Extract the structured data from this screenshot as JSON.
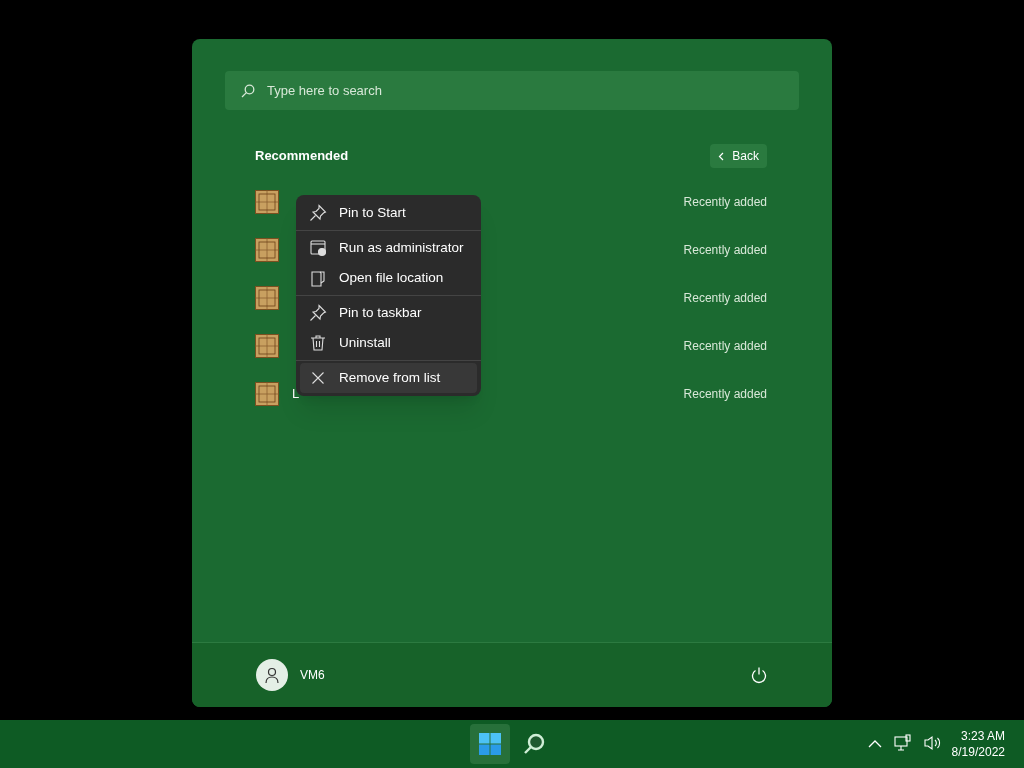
{
  "search": {
    "placeholder": "Type here to search"
  },
  "recommended": {
    "title": "Recommended",
    "back_button": "Back",
    "items": [
      {
        "detail": "Recently added"
      },
      {
        "detail": "Recently added"
      },
      {
        "detail": "Recently added"
      },
      {
        "detail": "Recently added"
      },
      {
        "name": "L",
        "detail": "Recently added"
      }
    ]
  },
  "context_menu": {
    "groups": [
      [
        {
          "kind": "pin",
          "label": "Pin to Start",
          "selected": false
        }
      ],
      [
        {
          "kind": "admin",
          "label": "Run as administrator",
          "selected": false
        },
        {
          "kind": "folder",
          "label": "Open file location",
          "selected": false
        }
      ],
      [
        {
          "kind": "pin",
          "label": "Pin to taskbar",
          "selected": false
        },
        {
          "kind": "trash",
          "label": "Uninstall",
          "selected": false
        }
      ],
      [
        {
          "kind": "close",
          "label": "Remove from list",
          "selected": true
        }
      ]
    ]
  },
  "user": {
    "name": "VM6"
  },
  "taskbar": {
    "start_selected": true,
    "time": "3:23 AM",
    "date": "8/19/2022"
  }
}
